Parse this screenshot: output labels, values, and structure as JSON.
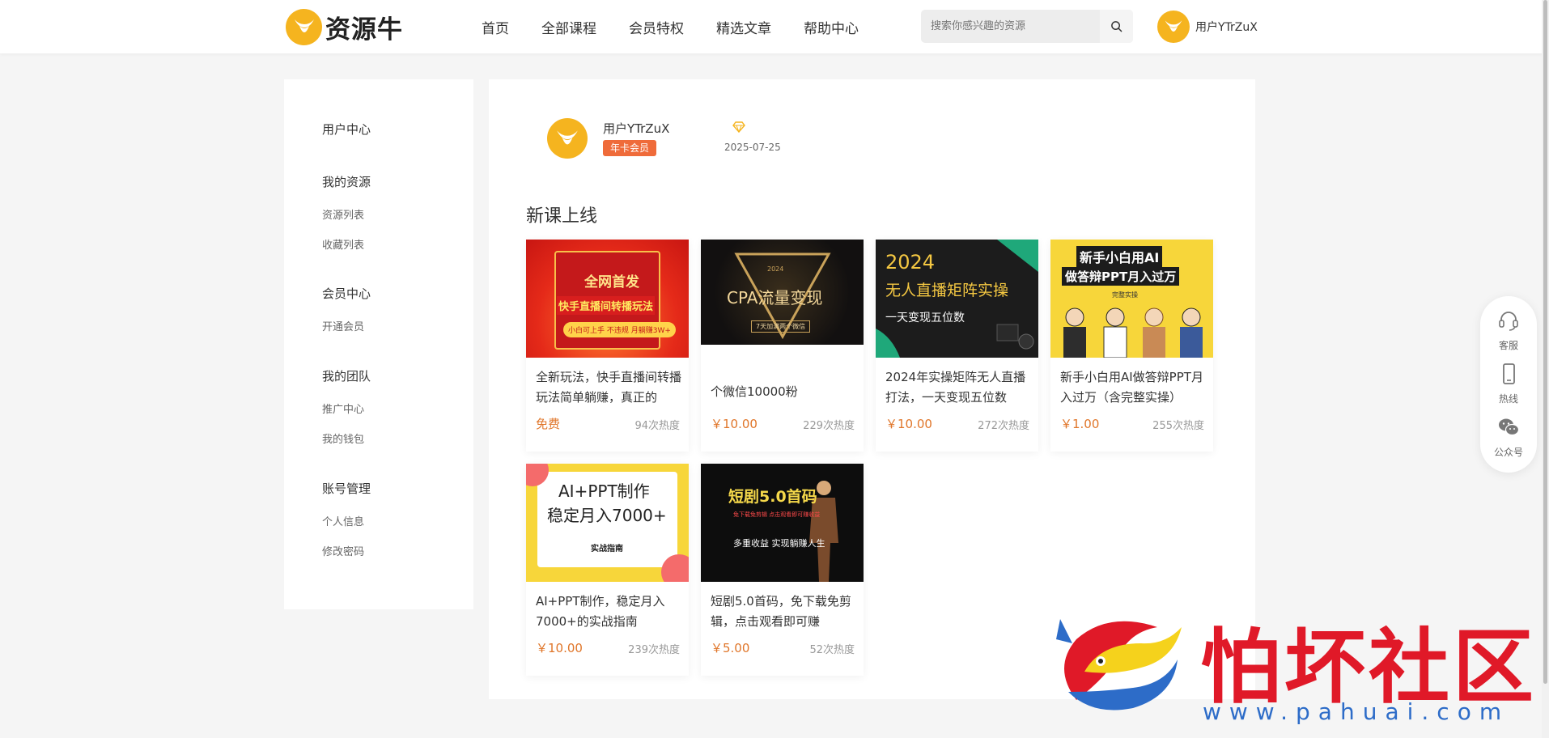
{
  "colors": {
    "brand": "#f5b41f",
    "accent_price": "#e0762a",
    "vip_badge": "#ef6b3a"
  },
  "header": {
    "logo_text": "资源牛",
    "nav": [
      "首页",
      "全部课程",
      "会员特权",
      "精选文章",
      "帮助中心"
    ],
    "search": {
      "placeholder": "搜索你感兴趣的资源",
      "icon": "search-icon"
    },
    "username": "用户YTrZuX"
  },
  "sidebar": {
    "user_center": "用户中心",
    "groups": [
      {
        "title": "我的资源",
        "links": [
          "资源列表",
          "收藏列表"
        ]
      },
      {
        "title": "会员中心",
        "links": [
          "开通会员"
        ]
      },
      {
        "title": "我的团队",
        "links": [
          "推广中心",
          "我的钱包"
        ]
      },
      {
        "title": "账号管理",
        "links": [
          "个人信息",
          "修改密码"
        ]
      }
    ]
  },
  "profile": {
    "name": "用户YTrZuX",
    "badge": "年卡会员",
    "date": "2025-07-25"
  },
  "section": {
    "title": "新课上线"
  },
  "courses": [
    {
      "title": "全新玩法，快手直播间转播玩法简单躺赚，真正的",
      "price": "免费",
      "heat": "94次热度",
      "thumb_lines": [
        "全网首发",
        "快手直播间转播玩法",
        "小白可上手 不违规 月躺赚3W+"
      ]
    },
    {
      "title": "个微信10000粉",
      "price": "￥10.00",
      "heat": "229次热度",
      "thumb_lines": [
        "2024",
        "CPA流量变现",
        "7天加满两个微信"
      ]
    },
    {
      "title": "2024年实操矩阵无人直播打法，一天变现五位数",
      "price": "￥10.00",
      "heat": "272次热度",
      "thumb_lines": [
        "2024",
        "无人直播矩阵实操",
        "一天变现五位数"
      ]
    },
    {
      "title": "新手小白用AI做答辩PPT月入过万（含完整实操）",
      "price": "￥1.00",
      "heat": "255次热度",
      "thumb_lines": [
        "新手小白用AI",
        "做答辩PPT月入过万",
        "完整实操"
      ]
    },
    {
      "title": "AI+PPT制作，稳定月入7000+的实战指南",
      "price": "￥10.00",
      "heat": "239次热度",
      "thumb_lines": [
        "AI+PPT制作",
        "稳定月入7000+",
        "实战指南"
      ]
    },
    {
      "title": "短剧5.0首码，免下载免剪辑，点击观看即可赚",
      "price": "￥5.00",
      "heat": "52次热度",
      "thumb_lines": [
        "短剧5.0首码",
        "免下载免剪辑 点击观看即可赚收益",
        "多重收益 实现躺赚人生"
      ]
    }
  ],
  "float_bar": [
    {
      "label": "客服",
      "icon": "headset-icon"
    },
    {
      "label": "热线",
      "icon": "phone-icon"
    },
    {
      "label": "公众号",
      "icon": "wechat-icon"
    }
  ],
  "watermark": {
    "text": "怕坏社区",
    "url": "www.pahuai.com"
  }
}
